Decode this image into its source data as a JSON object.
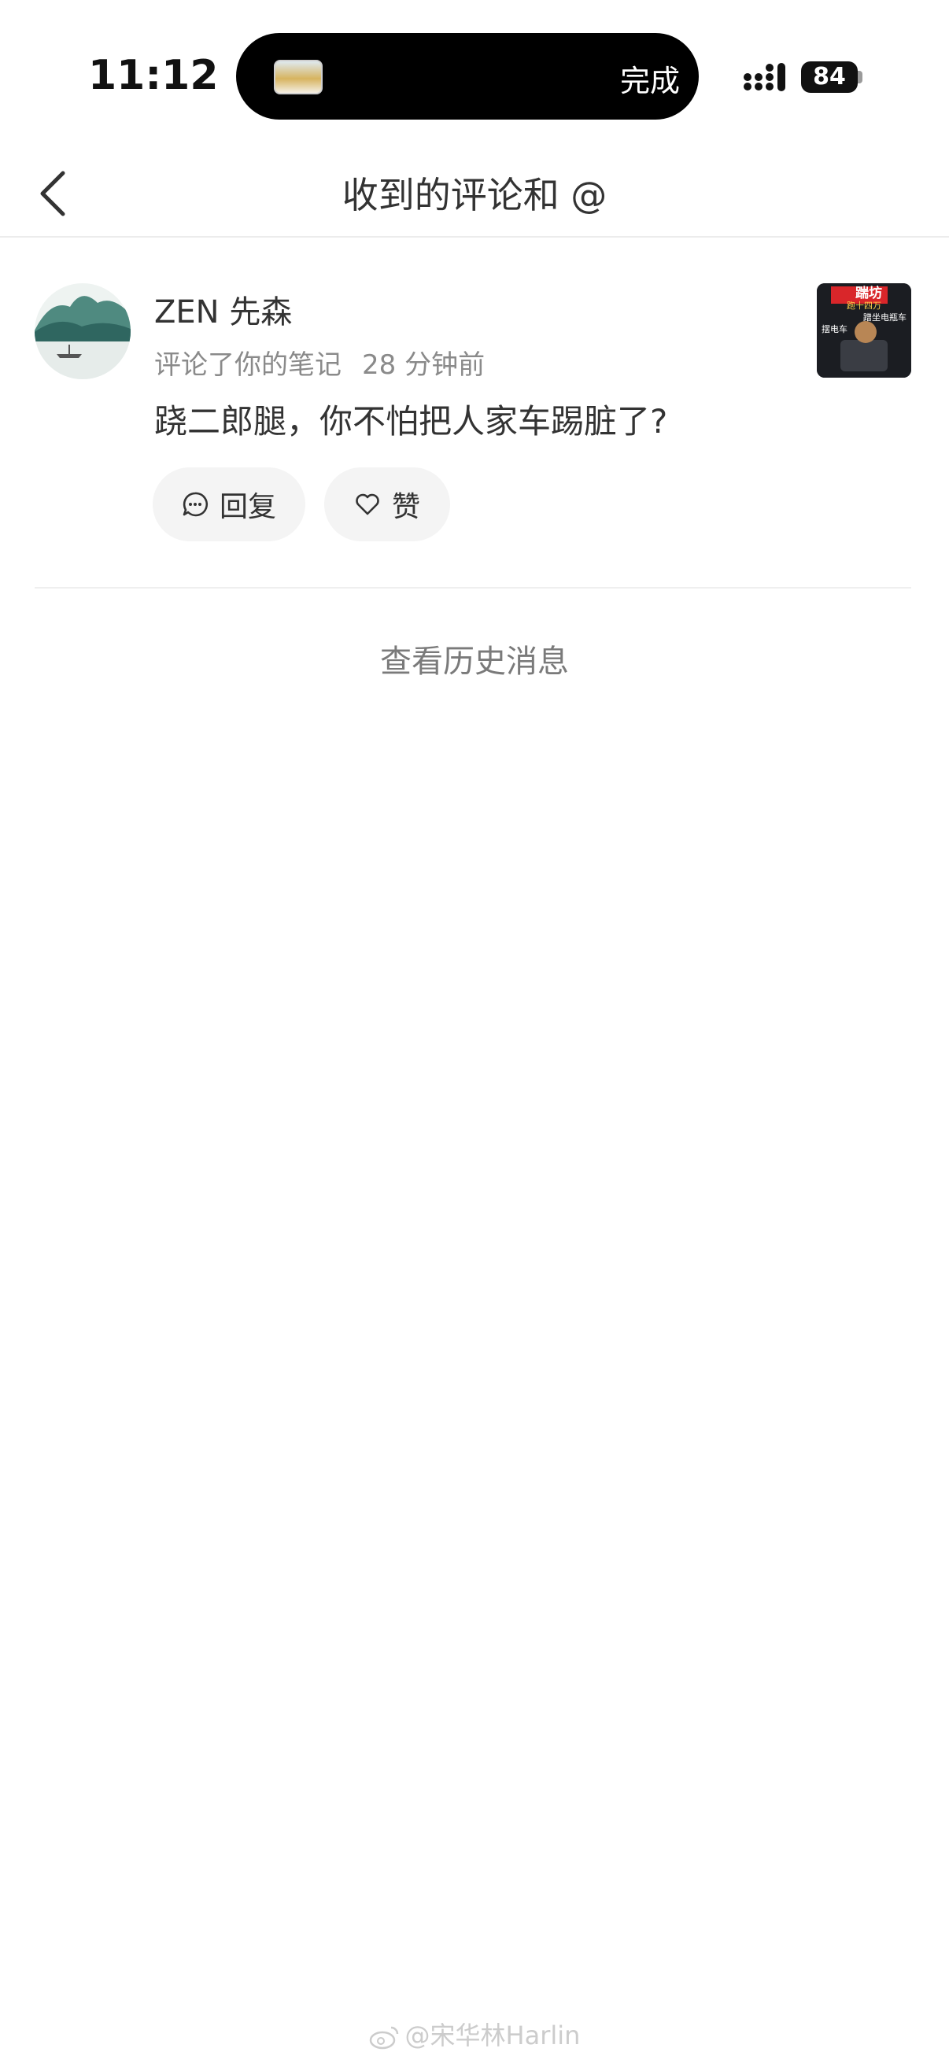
{
  "status_bar": {
    "time": "11:12",
    "island_action": "完成",
    "battery_level": "84"
  },
  "nav": {
    "title": "收到的评论和 @"
  },
  "notification": {
    "username": "ZEN 先森",
    "action_text": "评论了你的笔记",
    "time_ago": "28 分钟前",
    "comment": "跷二郎腿，你不怕把人家车踢脏了?",
    "reply_label": "回复",
    "like_label": "赞",
    "thumb_text": {
      "line1": "踹坊",
      "line2": "跑十四万",
      "line3": "蹭坐电瓶车",
      "line4": "摆电车"
    }
  },
  "history_link": "查看历史消息",
  "watermark": "@宋华林Harlin",
  "colors": {
    "background": "#ffffff",
    "text_primary": "#333333",
    "text_secondary": "#8a8a8a",
    "button_bg": "#f4f4f4",
    "divider": "#efefef"
  }
}
